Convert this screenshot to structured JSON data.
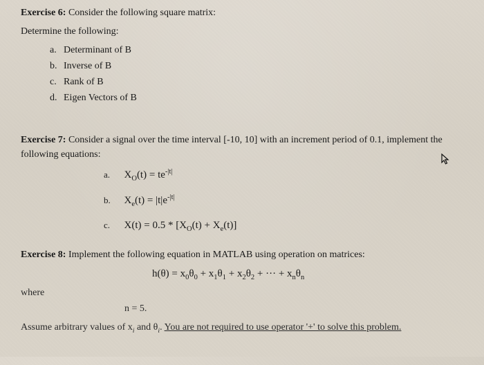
{
  "exercise6": {
    "heading": "Exercise 6:",
    "intro": "Consider the following square matrix:",
    "subheading": "Determine the following:",
    "items": [
      "Determinant of B",
      "Inverse of B",
      "Rank of B",
      "Eigen Vectors of B"
    ]
  },
  "exercise7": {
    "heading": "Exercise 7:",
    "intro": "Consider a signal over the time interval [-10, 10] with an increment period of 0.1, implement the following equations:",
    "equations": {
      "a": {
        "fn": "X",
        "subn": "O",
        "rhs": "te",
        "exp": "-|t|"
      },
      "b": {
        "fn": "X",
        "subn": "e",
        "rhs": "|t|e",
        "exp": "-|t|"
      },
      "c": {
        "lhs": "X(t) = 0.5 * [X",
        "sub1": "O",
        "mid": "(t) + X",
        "sub2": "e",
        "end": "(t)]"
      }
    }
  },
  "exercise8": {
    "heading": "Exercise 8:",
    "intro": "Implement the following equation in MATLAB using operation on matrices:",
    "hlabel": "h(θ) = x",
    "terms": [
      {
        "xsub": "0",
        "tsub": "0"
      },
      {
        "xsub": "1",
        "tsub": "1"
      },
      {
        "xsub": "2",
        "tsub": "2"
      },
      {
        "xsub": "n",
        "tsub": "n"
      }
    ],
    "where": "where",
    "n_eq": "n = 5.",
    "assume_pre": "Assume arbitrary values of x",
    "assume_mid": " and θ",
    "assume_post_u": "You are not required to use operator '+' to solve this problem."
  }
}
